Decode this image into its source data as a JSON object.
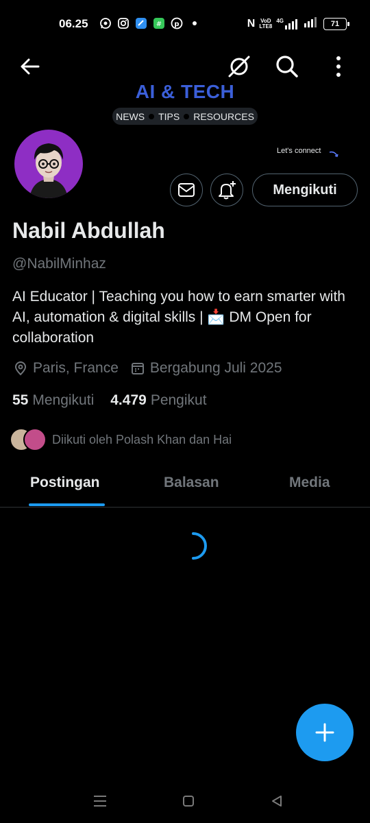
{
  "status_bar": {
    "time": "06.25",
    "app_icons": [
      "whatsapp-icon",
      "instagram-icon",
      "telegram-icon",
      "wechat-icon",
      "pinterest-icon",
      "dot-icon"
    ],
    "nfc": "N",
    "volte_top": "VoD",
    "volte_bottom": "LTE8",
    "network": "4G",
    "battery": "71"
  },
  "header": {
    "banner_title": "AI & TECH",
    "banner_tags": [
      "NEWS",
      "TIPS",
      "RESOURCES"
    ],
    "lets_connect": "Let's connect"
  },
  "profile": {
    "display_name": "Nabil Abdullah",
    "handle": "@NabilMinhaz",
    "bio": "AI Educator | Teaching you how to earn smarter with AI, automation & digital skills | 📩 DM Open for collaboration",
    "location": "Paris, France",
    "joined": "Bergabung Juli 2025",
    "following_count": "55",
    "following_label": "Mengikuti",
    "followers_count": "4.479",
    "followers_label": "Pengikut",
    "followed_by": "Diikuti oleh Polash Khan dan Hai",
    "follow_button": "Mengikuti"
  },
  "tabs": [
    {
      "label": "Postingan",
      "active": true
    },
    {
      "label": "Balasan",
      "active": false
    },
    {
      "label": "Media",
      "active": false
    }
  ],
  "colors": {
    "accent": "#1d9bf0",
    "avatar_bg": "#8e2ec4",
    "banner_title": "#3b5fd9",
    "muted_text": "#71767b"
  }
}
